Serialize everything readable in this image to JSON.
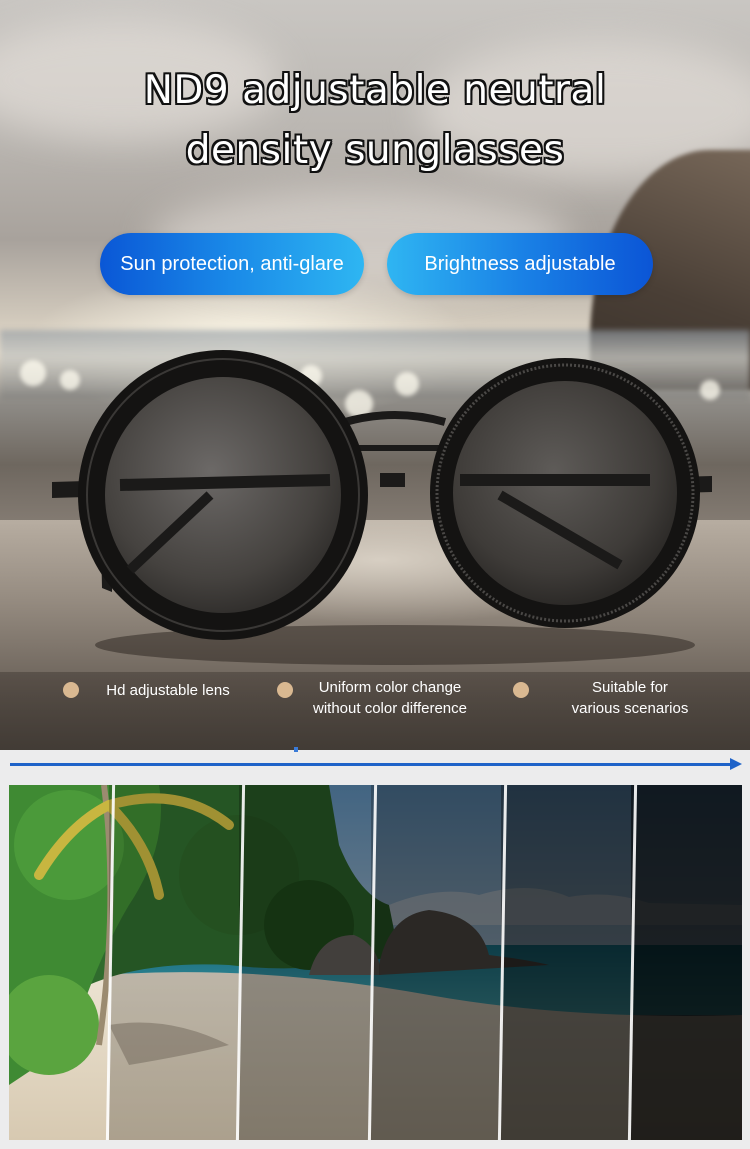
{
  "title": {
    "line1": "ND9 adjustable neutral",
    "line2": "density sunglasses"
  },
  "badges": [
    {
      "label": "Sun protection, anti-glare"
    },
    {
      "label": "Brightness adjustable"
    }
  ],
  "features": [
    {
      "line1": "Hd adjustable lens",
      "line2": ""
    },
    {
      "line1": "Uniform color change",
      "line2": "without color difference"
    },
    {
      "line1": "Suitable for",
      "line2": "various scenarios"
    }
  ],
  "colors": {
    "badge_gradient_start": "#0a57d6",
    "badge_gradient_end": "#2eb6f2",
    "feature_dot": "#d9b891",
    "arrow": "#1f63c9"
  },
  "icons": [
    "sunglasses-illustration",
    "feature-dot-icon",
    "darkness-arrow-icon"
  ],
  "darkness_steps": [
    0,
    0.2,
    0.4,
    0.55,
    0.7,
    0.85
  ]
}
